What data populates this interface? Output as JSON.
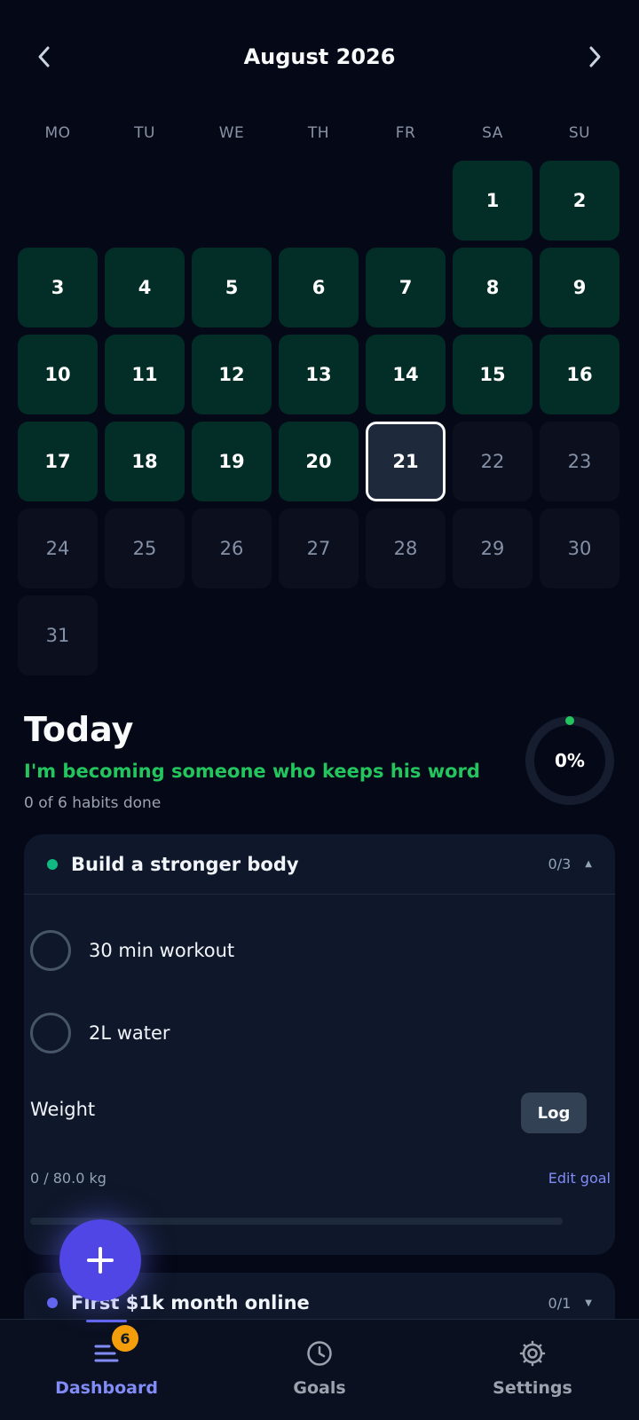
{
  "calendar": {
    "month_label": "August 2026",
    "weekdays": [
      "MO",
      "TU",
      "WE",
      "TH",
      "FR",
      "SA",
      "SU"
    ],
    "days": [
      {
        "d": "",
        "s": "blank"
      },
      {
        "d": "",
        "s": "blank"
      },
      {
        "d": "",
        "s": "blank"
      },
      {
        "d": "",
        "s": "blank"
      },
      {
        "d": "",
        "s": "blank"
      },
      {
        "d": "1",
        "s": "done"
      },
      {
        "d": "2",
        "s": "done"
      },
      {
        "d": "3",
        "s": "done"
      },
      {
        "d": "4",
        "s": "done"
      },
      {
        "d": "5",
        "s": "done"
      },
      {
        "d": "6",
        "s": "done"
      },
      {
        "d": "7",
        "s": "done"
      },
      {
        "d": "8",
        "s": "done"
      },
      {
        "d": "9",
        "s": "done"
      },
      {
        "d": "10",
        "s": "done"
      },
      {
        "d": "11",
        "s": "done"
      },
      {
        "d": "12",
        "s": "done"
      },
      {
        "d": "13",
        "s": "done"
      },
      {
        "d": "14",
        "s": "done"
      },
      {
        "d": "15",
        "s": "done"
      },
      {
        "d": "16",
        "s": "done"
      },
      {
        "d": "17",
        "s": "done"
      },
      {
        "d": "18",
        "s": "done"
      },
      {
        "d": "19",
        "s": "done"
      },
      {
        "d": "20",
        "s": "done"
      },
      {
        "d": "21",
        "s": "today"
      },
      {
        "d": "22",
        "s": "future"
      },
      {
        "d": "23",
        "s": "future"
      },
      {
        "d": "24",
        "s": "future"
      },
      {
        "d": "25",
        "s": "future"
      },
      {
        "d": "26",
        "s": "future"
      },
      {
        "d": "27",
        "s": "future"
      },
      {
        "d": "28",
        "s": "future"
      },
      {
        "d": "29",
        "s": "future"
      },
      {
        "d": "30",
        "s": "future"
      },
      {
        "d": "31",
        "s": "future"
      }
    ]
  },
  "today": {
    "title": "Today",
    "identity": "I'm becoming someone who keeps his word",
    "habits_done": "0 of 6 habits done",
    "progress_label": "0%",
    "progress": 0
  },
  "goals": [
    {
      "name": "Build a stronger body",
      "count": "0/3",
      "color": "#10b981",
      "expanded": true,
      "habits": [
        "30 min workout",
        "2L water"
      ],
      "metric": {
        "label": "Weight",
        "log_label": "Log",
        "value_text": "0 / 80.0 kg",
        "edit_label": "Edit goal",
        "progress": 0
      }
    },
    {
      "name": "First $1k month online",
      "count": "0/1",
      "color": "#6366f1",
      "expanded": false
    }
  ],
  "nav": {
    "items": [
      {
        "label": "Dashboard",
        "icon": "list-icon",
        "active": true,
        "badge": "6"
      },
      {
        "label": "Goals",
        "icon": "clock-icon",
        "active": false
      },
      {
        "label": "Settings",
        "icon": "gear-icon",
        "active": false
      }
    ]
  },
  "colors": {
    "done_day": "#032d27",
    "accent": "#6366f1",
    "identity_text": "#22c55e",
    "badge": "#f59e0b"
  }
}
